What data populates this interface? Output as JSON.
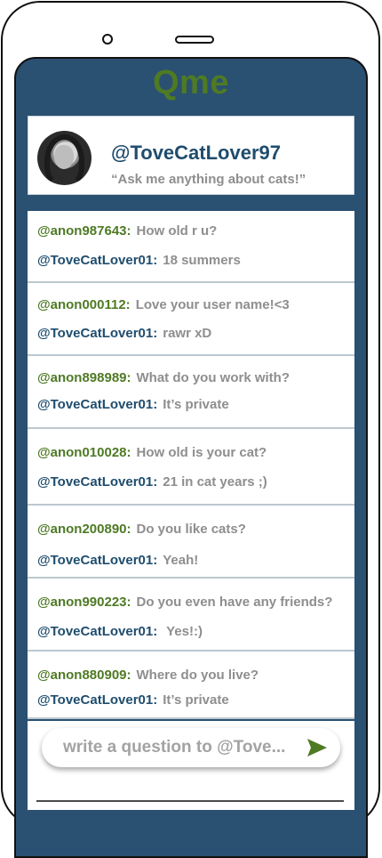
{
  "app": {
    "title": "Qme"
  },
  "profile": {
    "username": "@ToveCatLover97",
    "bio": "“Ask me anything about cats!”"
  },
  "qa": [
    {
      "asker": "@anon987643:",
      "question": "How old r u?",
      "responder": "@ToveCatLover01:",
      "answer": "18 summers"
    },
    {
      "asker": "@anon000112:",
      "question": "Love your user name!<3",
      "responder": "@ToveCatLover01:",
      "answer": "rawr xD"
    },
    {
      "asker": "@anon898989:",
      "question": "What do you work with?",
      "responder": "@ToveCatLover01:",
      "answer": "It’s private"
    },
    {
      "asker": "@anon010028:",
      "question": "How old is your cat?",
      "responder": "@ToveCatLover01:",
      "answer": "21 in cat years ;)"
    },
    {
      "asker": "@anon200890:",
      "question": "Do you like cats?",
      "responder": "@ToveCatLover01:",
      "answer": "Yeah!"
    },
    {
      "asker": "@anon990223:",
      "question": "Do you even have any friends?",
      "responder": "@ToveCatLover01:",
      "answer": " Yes!:)"
    },
    {
      "asker": "@anon880909:",
      "question": "Where do you live?",
      "responder": "@ToveCatLover01:",
      "answer": "It’s private"
    }
  ],
  "compose": {
    "placeholder": "write a question to @Tove...",
    "send_icon": "send-arrow-icon"
  },
  "colors": {
    "screen": "#2a5072",
    "brand_green": "#4e7a24",
    "user_blue": "#1f4d6e",
    "muted_text": "#8e8e8e"
  }
}
